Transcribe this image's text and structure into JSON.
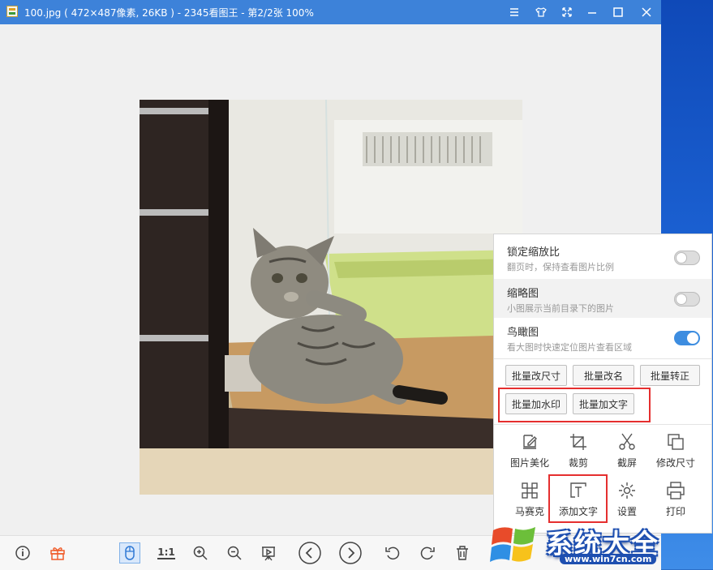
{
  "window": {
    "title": "100.jpg ( 472×487像素, 26KB ) - 2345看图王 - 第2/2张 100%"
  },
  "title_buttons": [
    "menu-icon",
    "skin-icon",
    "fullscreen-icon",
    "minimize-icon",
    "maximize-icon",
    "close-icon"
  ],
  "panel": {
    "toggles": [
      {
        "title": "锁定缩放比",
        "subtitle": "翻页时，保持查看图片比例",
        "on": false
      },
      {
        "title": "缩略图",
        "subtitle": "小图展示当前目录下的图片",
        "on": false
      },
      {
        "title": "鸟瞰图",
        "subtitle": "看大图时快速定位图片查看区域",
        "on": true
      }
    ],
    "batch_buttons": [
      "批量改尺寸",
      "批量改名",
      "批量转正",
      "批量加水印",
      "批量加文字"
    ],
    "tools": [
      {
        "label": "图片美化",
        "icon": "edit-icon"
      },
      {
        "label": "裁剪",
        "icon": "crop-icon"
      },
      {
        "label": "截屏",
        "icon": "scissors-icon"
      },
      {
        "label": "修改尺寸",
        "icon": "resize-icon"
      },
      {
        "label": "马赛克",
        "icon": "mosaic-icon"
      },
      {
        "label": "添加文字",
        "icon": "text-icon"
      },
      {
        "label": "设置",
        "icon": "gear-icon"
      },
      {
        "label": "打印",
        "icon": "printer-icon"
      }
    ]
  },
  "bottom_toolbar": {
    "actual_size_label": "1:1",
    "icons": [
      "info-icon",
      "gift-icon",
      "mouse-icon",
      "actual-size-icon",
      "zoom-in-icon",
      "zoom-out-icon",
      "slideshow-icon",
      "prev-icon",
      "next-icon",
      "rotate-left-icon",
      "rotate-right-icon",
      "delete-icon"
    ]
  },
  "watermark": {
    "text": "系统大全",
    "url": "www.win7cn.com"
  },
  "colors": {
    "titlebar": "#3d82d9",
    "accent": "#3d8de0",
    "highlight_box": "#e52f2f"
  }
}
